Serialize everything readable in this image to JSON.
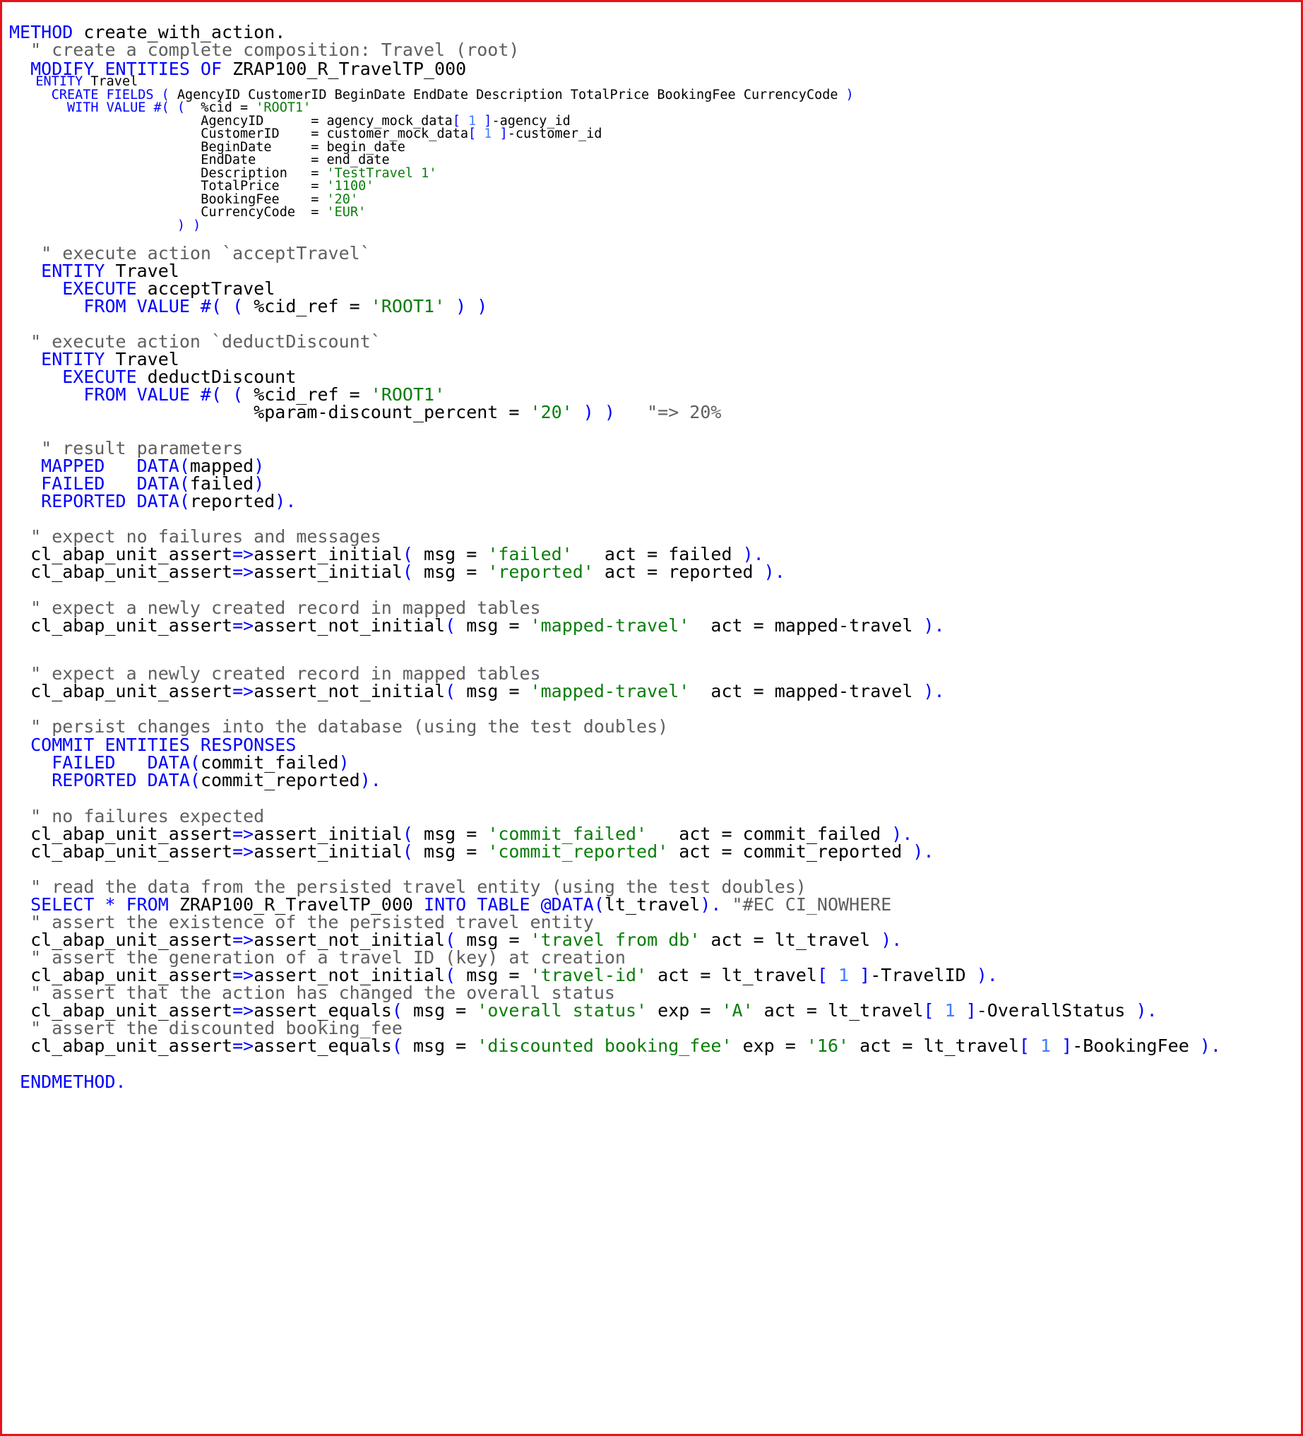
{
  "editor": {
    "language": "ABAP",
    "colors": {
      "border": "#e8131b",
      "keyword": "#0000ff",
      "string": "#0a7d0a",
      "comment": "#5f5f5f",
      "number": "#3f7fff",
      "text": "#000000"
    },
    "lines": [
      {
        "size": "big",
        "segments": [
          {
            "t": "kw",
            "v": "METHOD "
          },
          {
            "t": "plain",
            "v": "create_with_action."
          }
        ]
      },
      {
        "size": "big",
        "segments": [
          {
            "t": "cmt",
            "v": "  \" create a complete composition: Travel (root)"
          }
        ]
      },
      {
        "size": "big",
        "segments": [
          {
            "t": "kw",
            "v": "  MODIFY ENTITIES OF "
          },
          {
            "t": "plain",
            "v": "ZRAP100_R_TravelTP_000"
          }
        ]
      },
      {
        "size": "small",
        "segments": [
          {
            "t": "kw",
            "v": "   ENTITY "
          },
          {
            "t": "plain",
            "v": "Travel"
          }
        ]
      },
      {
        "size": "small",
        "segments": [
          {
            "t": "kw",
            "v": "     CREATE FIELDS ( "
          },
          {
            "t": "plain",
            "v": "AgencyID CustomerID BeginDate EndDate Description TotalPrice BookingFee CurrencyCode "
          },
          {
            "t": "kw",
            "v": ")"
          }
        ]
      },
      {
        "size": "small",
        "segments": [
          {
            "t": "kw",
            "v": "       WITH VALUE #( (  "
          },
          {
            "t": "plain",
            "v": "%cid = "
          },
          {
            "t": "str",
            "v": "'ROOT1'"
          }
        ]
      },
      {
        "size": "small",
        "segments": [
          {
            "t": "plain",
            "v": "                        AgencyID      = agency_mock_data"
          },
          {
            "t": "kw",
            "v": "[ "
          },
          {
            "t": "num",
            "v": "1"
          },
          {
            "t": "kw",
            "v": " ]"
          },
          {
            "t": "plain",
            "v": "-agency_id"
          }
        ]
      },
      {
        "size": "small",
        "segments": [
          {
            "t": "plain",
            "v": "                        CustomerID    = customer_mock_data"
          },
          {
            "t": "kw",
            "v": "[ "
          },
          {
            "t": "num",
            "v": "1"
          },
          {
            "t": "kw",
            "v": " ]"
          },
          {
            "t": "plain",
            "v": "-customer_id"
          }
        ]
      },
      {
        "size": "small",
        "segments": [
          {
            "t": "plain",
            "v": "                        BeginDate     = begin_date"
          }
        ]
      },
      {
        "size": "small",
        "segments": [
          {
            "t": "plain",
            "v": "                        EndDate       = end_date"
          }
        ]
      },
      {
        "size": "small",
        "segments": [
          {
            "t": "plain",
            "v": "                        Description   = "
          },
          {
            "t": "str",
            "v": "'TestTravel 1'"
          }
        ]
      },
      {
        "size": "small",
        "segments": [
          {
            "t": "plain",
            "v": "                        TotalPrice    = "
          },
          {
            "t": "str",
            "v": "'1100'"
          }
        ]
      },
      {
        "size": "small",
        "segments": [
          {
            "t": "plain",
            "v": "                        BookingFee    = "
          },
          {
            "t": "str",
            "v": "'20'"
          }
        ]
      },
      {
        "size": "small",
        "segments": [
          {
            "t": "plain",
            "v": "                        CurrencyCode  = "
          },
          {
            "t": "str",
            "v": "'EUR'"
          }
        ]
      },
      {
        "size": "small",
        "segments": [
          {
            "t": "kw",
            "v": "                     ) )"
          }
        ]
      },
      {
        "size": "big",
        "segments": [
          {
            "t": "cmt",
            "v": "   \" execute action `acceptTravel`"
          }
        ]
      },
      {
        "size": "big",
        "segments": [
          {
            "t": "kw",
            "v": "   ENTITY "
          },
          {
            "t": "plain",
            "v": "Travel"
          }
        ]
      },
      {
        "size": "big",
        "segments": [
          {
            "t": "kw",
            "v": "     EXECUTE "
          },
          {
            "t": "plain",
            "v": "acceptTravel"
          }
        ]
      },
      {
        "size": "big",
        "segments": [
          {
            "t": "kw",
            "v": "       FROM VALUE #( ( "
          },
          {
            "t": "plain",
            "v": "%cid_ref = "
          },
          {
            "t": "str",
            "v": "'ROOT1'"
          },
          {
            "t": "kw",
            "v": " ) )"
          }
        ]
      },
      {
        "size": "big",
        "segments": [
          {
            "t": "cmt",
            "v": "  \" execute action `deductDiscount`"
          }
        ]
      },
      {
        "size": "big",
        "segments": [
          {
            "t": "kw",
            "v": "   ENTITY "
          },
          {
            "t": "plain",
            "v": "Travel"
          }
        ]
      },
      {
        "size": "big",
        "segments": [
          {
            "t": "kw",
            "v": "     EXECUTE "
          },
          {
            "t": "plain",
            "v": "deductDiscount"
          }
        ]
      },
      {
        "size": "big",
        "segments": [
          {
            "t": "kw",
            "v": "       FROM VALUE #( ( "
          },
          {
            "t": "plain",
            "v": "%cid_ref = "
          },
          {
            "t": "str",
            "v": "'ROOT1'"
          }
        ]
      },
      {
        "size": "big",
        "segments": [
          {
            "t": "plain",
            "v": "                       %param-discount_percent = "
          },
          {
            "t": "str",
            "v": "'20'"
          },
          {
            "t": "kw",
            "v": " ) )"
          },
          {
            "t": "cmt",
            "v": "   \"=> 20%"
          }
        ]
      },
      {
        "size": "big",
        "segments": [
          {
            "t": "cmt",
            "v": "   \" result parameters"
          }
        ]
      },
      {
        "size": "big",
        "segments": [
          {
            "t": "kw",
            "v": "   MAPPED   DATA("
          },
          {
            "t": "plain",
            "v": "mapped"
          },
          {
            "t": "kw",
            "v": ")"
          }
        ]
      },
      {
        "size": "big",
        "segments": [
          {
            "t": "kw",
            "v": "   FAILED   DATA("
          },
          {
            "t": "plain",
            "v": "failed"
          },
          {
            "t": "kw",
            "v": ")"
          }
        ]
      },
      {
        "size": "big",
        "segments": [
          {
            "t": "kw",
            "v": "   REPORTED DATA("
          },
          {
            "t": "plain",
            "v": "reported"
          },
          {
            "t": "kw",
            "v": ")."
          }
        ]
      },
      {
        "size": "big",
        "segments": [
          {
            "t": "cmt",
            "v": "  \" expect no failures and messages"
          }
        ]
      },
      {
        "size": "big",
        "segments": [
          {
            "t": "plain",
            "v": "  cl_abap_unit_assert"
          },
          {
            "t": "kw",
            "v": "=>"
          },
          {
            "t": "plain",
            "v": "assert_initial"
          },
          {
            "t": "kw",
            "v": "( "
          },
          {
            "t": "plain",
            "v": "msg = "
          },
          {
            "t": "str",
            "v": "'failed'"
          },
          {
            "t": "plain",
            "v": "   act = failed "
          },
          {
            "t": "kw",
            "v": ")."
          }
        ]
      },
      {
        "size": "big",
        "segments": [
          {
            "t": "plain",
            "v": "  cl_abap_unit_assert"
          },
          {
            "t": "kw",
            "v": "=>"
          },
          {
            "t": "plain",
            "v": "assert_initial"
          },
          {
            "t": "kw",
            "v": "( "
          },
          {
            "t": "plain",
            "v": "msg = "
          },
          {
            "t": "str",
            "v": "'reported'"
          },
          {
            "t": "plain",
            "v": " act = reported "
          },
          {
            "t": "kw",
            "v": ")."
          }
        ]
      },
      {
        "size": "big",
        "segments": [
          {
            "t": "cmt",
            "v": "  \" expect a newly created record in mapped tables"
          }
        ]
      },
      {
        "size": "big",
        "segments": [
          {
            "t": "plain",
            "v": "  cl_abap_unit_assert"
          },
          {
            "t": "kw",
            "v": "=>"
          },
          {
            "t": "plain",
            "v": "assert_not_initial"
          },
          {
            "t": "kw",
            "v": "( "
          },
          {
            "t": "plain",
            "v": "msg = "
          },
          {
            "t": "str",
            "v": "'mapped-travel'"
          },
          {
            "t": "plain",
            "v": "  act = mapped-travel "
          },
          {
            "t": "kw",
            "v": ")."
          }
        ]
      },
      {
        "size": "big",
        "segments": [
          {
            "t": "cmt",
            "v": "  \" expect a newly created record in mapped tables"
          }
        ]
      },
      {
        "size": "big",
        "segments": [
          {
            "t": "plain",
            "v": "  cl_abap_unit_assert"
          },
          {
            "t": "kw",
            "v": "=>"
          },
          {
            "t": "plain",
            "v": "assert_not_initial"
          },
          {
            "t": "kw",
            "v": "( "
          },
          {
            "t": "plain",
            "v": "msg = "
          },
          {
            "t": "str",
            "v": "'mapped-travel'"
          },
          {
            "t": "plain",
            "v": "  act = mapped-travel "
          },
          {
            "t": "kw",
            "v": ")."
          }
        ]
      },
      {
        "size": "big",
        "segments": [
          {
            "t": "cmt",
            "v": "  \" persist changes into the database (using the test doubles)"
          }
        ]
      },
      {
        "size": "big",
        "segments": [
          {
            "t": "kw",
            "v": "  COMMIT ENTITIES RESPONSES"
          }
        ]
      },
      {
        "size": "big",
        "segments": [
          {
            "t": "kw",
            "v": "    FAILED   DATA("
          },
          {
            "t": "plain",
            "v": "commit_failed"
          },
          {
            "t": "kw",
            "v": ")"
          }
        ]
      },
      {
        "size": "big",
        "segments": [
          {
            "t": "kw",
            "v": "    REPORTED DATA("
          },
          {
            "t": "plain",
            "v": "commit_reported"
          },
          {
            "t": "kw",
            "v": ")."
          }
        ]
      },
      {
        "size": "big",
        "segments": [
          {
            "t": "cmt",
            "v": "  \" no failures expected"
          }
        ]
      },
      {
        "size": "big",
        "segments": [
          {
            "t": "plain",
            "v": "  cl_abap_unit_assert"
          },
          {
            "t": "kw",
            "v": "=>"
          },
          {
            "t": "plain",
            "v": "assert_initial"
          },
          {
            "t": "kw",
            "v": "( "
          },
          {
            "t": "plain",
            "v": "msg = "
          },
          {
            "t": "str",
            "v": "'commit_failed'"
          },
          {
            "t": "plain",
            "v": "   act = commit_failed "
          },
          {
            "t": "kw",
            "v": ")."
          }
        ]
      },
      {
        "size": "big",
        "segments": [
          {
            "t": "plain",
            "v": "  cl_abap_unit_assert"
          },
          {
            "t": "kw",
            "v": "=>"
          },
          {
            "t": "plain",
            "v": "assert_initial"
          },
          {
            "t": "kw",
            "v": "( "
          },
          {
            "t": "plain",
            "v": "msg = "
          },
          {
            "t": "str",
            "v": "'commit_reported'"
          },
          {
            "t": "plain",
            "v": " act = commit_reported "
          },
          {
            "t": "kw",
            "v": ")."
          }
        ]
      },
      {
        "size": "big",
        "segments": [
          {
            "t": "cmt",
            "v": "  \" read the data from the persisted travel entity (using the test doubles)"
          }
        ]
      },
      {
        "size": "big",
        "segments": [
          {
            "t": "kw",
            "v": "  SELECT * FROM "
          },
          {
            "t": "plain",
            "v": "ZRAP100_R_TravelTP_000 "
          },
          {
            "t": "kw",
            "v": "INTO TABLE @DATA("
          },
          {
            "t": "plain",
            "v": "lt_travel"
          },
          {
            "t": "kw",
            "v": ")."
          },
          {
            "t": "cmt",
            "v": " \"#EC CI_NOWHERE"
          }
        ]
      },
      {
        "size": "big",
        "segments": [
          {
            "t": "cmt",
            "v": "  \" assert the existence of the persisted travel entity"
          }
        ]
      },
      {
        "size": "big",
        "segments": [
          {
            "t": "plain",
            "v": "  cl_abap_unit_assert"
          },
          {
            "t": "kw",
            "v": "=>"
          },
          {
            "t": "plain",
            "v": "assert_not_initial"
          },
          {
            "t": "kw",
            "v": "( "
          },
          {
            "t": "plain",
            "v": "msg = "
          },
          {
            "t": "str",
            "v": "'travel from db'"
          },
          {
            "t": "plain",
            "v": " act = lt_travel "
          },
          {
            "t": "kw",
            "v": ")."
          }
        ]
      },
      {
        "size": "big",
        "segments": [
          {
            "t": "cmt",
            "v": "  \" assert the generation of a travel ID (key) at creation"
          }
        ]
      },
      {
        "size": "big",
        "segments": [
          {
            "t": "plain",
            "v": "  cl_abap_unit_assert"
          },
          {
            "t": "kw",
            "v": "=>"
          },
          {
            "t": "plain",
            "v": "assert_not_initial"
          },
          {
            "t": "kw",
            "v": "( "
          },
          {
            "t": "plain",
            "v": "msg = "
          },
          {
            "t": "str",
            "v": "'travel-id'"
          },
          {
            "t": "plain",
            "v": " act = lt_travel"
          },
          {
            "t": "kw",
            "v": "[ "
          },
          {
            "t": "num",
            "v": "1"
          },
          {
            "t": "kw",
            "v": " ]"
          },
          {
            "t": "plain",
            "v": "-TravelID "
          },
          {
            "t": "kw",
            "v": ")."
          }
        ]
      },
      {
        "size": "big",
        "segments": [
          {
            "t": "cmt",
            "v": "  \" assert that the action has changed the overall status"
          }
        ]
      },
      {
        "size": "big",
        "segments": [
          {
            "t": "plain",
            "v": "  cl_abap_unit_assert"
          },
          {
            "t": "kw",
            "v": "=>"
          },
          {
            "t": "plain",
            "v": "assert_equals"
          },
          {
            "t": "kw",
            "v": "( "
          },
          {
            "t": "plain",
            "v": "msg = "
          },
          {
            "t": "str",
            "v": "'overall status'"
          },
          {
            "t": "plain",
            "v": " exp = "
          },
          {
            "t": "str",
            "v": "'A'"
          },
          {
            "t": "plain",
            "v": " act = lt_travel"
          },
          {
            "t": "kw",
            "v": "[ "
          },
          {
            "t": "num",
            "v": "1"
          },
          {
            "t": "kw",
            "v": " ]"
          },
          {
            "t": "plain",
            "v": "-OverallStatus "
          },
          {
            "t": "kw",
            "v": ")."
          }
        ]
      },
      {
        "size": "big",
        "segments": [
          {
            "t": "cmt",
            "v": "  \" assert the discounted booking_fee"
          }
        ]
      },
      {
        "size": "big",
        "segments": [
          {
            "t": "plain",
            "v": "  cl_abap_unit_assert"
          },
          {
            "t": "kw",
            "v": "=>"
          },
          {
            "t": "plain",
            "v": "assert_equals"
          },
          {
            "t": "kw",
            "v": "( "
          },
          {
            "t": "plain",
            "v": "msg = "
          },
          {
            "t": "str",
            "v": "'discounted booking_fee'"
          },
          {
            "t": "plain",
            "v": " exp = "
          },
          {
            "t": "str",
            "v": "'16'"
          },
          {
            "t": "plain",
            "v": " act = lt_travel"
          },
          {
            "t": "kw",
            "v": "[ "
          },
          {
            "t": "num",
            "v": "1"
          },
          {
            "t": "kw",
            "v": " ]"
          },
          {
            "t": "plain",
            "v": "-BookingFee "
          },
          {
            "t": "kw",
            "v": ")."
          }
        ]
      },
      {
        "size": "big",
        "segments": [
          {
            "t": "kw",
            "v": " ENDMETHOD."
          }
        ]
      }
    ]
  }
}
